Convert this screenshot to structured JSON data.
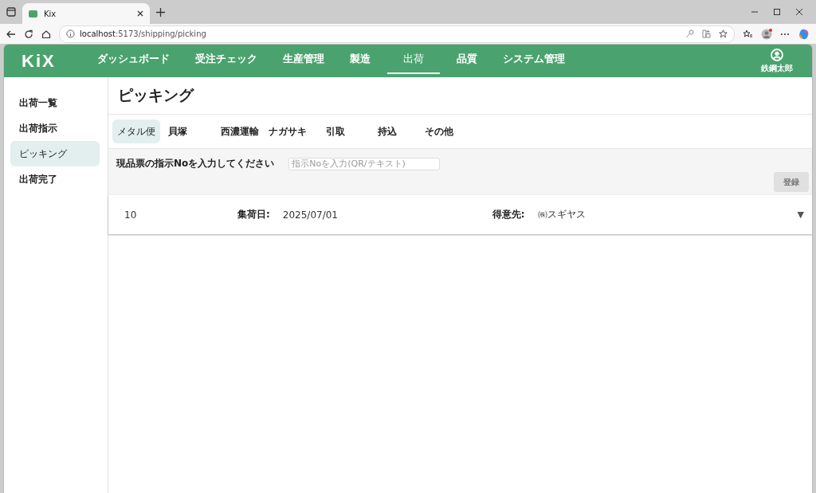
{
  "browser": {
    "tab_title": "Kix",
    "url_host": "localhost",
    "url_path": ":5173/shipping/picking"
  },
  "header": {
    "logo": "KiX",
    "nav": [
      {
        "label": "ダッシュボード",
        "selected": false
      },
      {
        "label": "受注チェック",
        "selected": false
      },
      {
        "label": "生産管理",
        "selected": false
      },
      {
        "label": "製造",
        "selected": false
      },
      {
        "label": "出荷",
        "selected": true
      },
      {
        "label": "品質",
        "selected": false
      },
      {
        "label": "システム管理",
        "selected": false
      }
    ],
    "user": "鉄鋼太郎"
  },
  "sidebar": {
    "items": [
      {
        "label": "出荷一覧",
        "selected": false
      },
      {
        "label": "出荷指示",
        "selected": false
      },
      {
        "label": "ピッキング",
        "selected": true
      },
      {
        "label": "出荷完了",
        "selected": false
      }
    ]
  },
  "page_title": "ピッキング",
  "carrier_tabs": [
    {
      "label": "メタル便",
      "selected": true
    },
    {
      "label": "貝塚",
      "selected": false
    },
    {
      "label": "西濃運輸",
      "selected": false
    },
    {
      "label": "ナガサキ",
      "selected": false
    },
    {
      "label": "引取",
      "selected": false
    },
    {
      "label": "持込",
      "selected": false
    },
    {
      "label": "その他",
      "selected": false
    }
  ],
  "scan": {
    "label": "現品票の指示Noを入力してください",
    "placeholder": "指示Noを入力(QR/テキスト)",
    "button": {
      "label": "登録",
      "disabled": true
    }
  },
  "records": [
    {
      "number": "10",
      "date_label": "集荷日:",
      "date": "2025/07/01",
      "customer_label": "得意先:",
      "customer": "㈱スギヤス",
      "toggle": "▼",
      "expanded": false
    }
  ]
}
